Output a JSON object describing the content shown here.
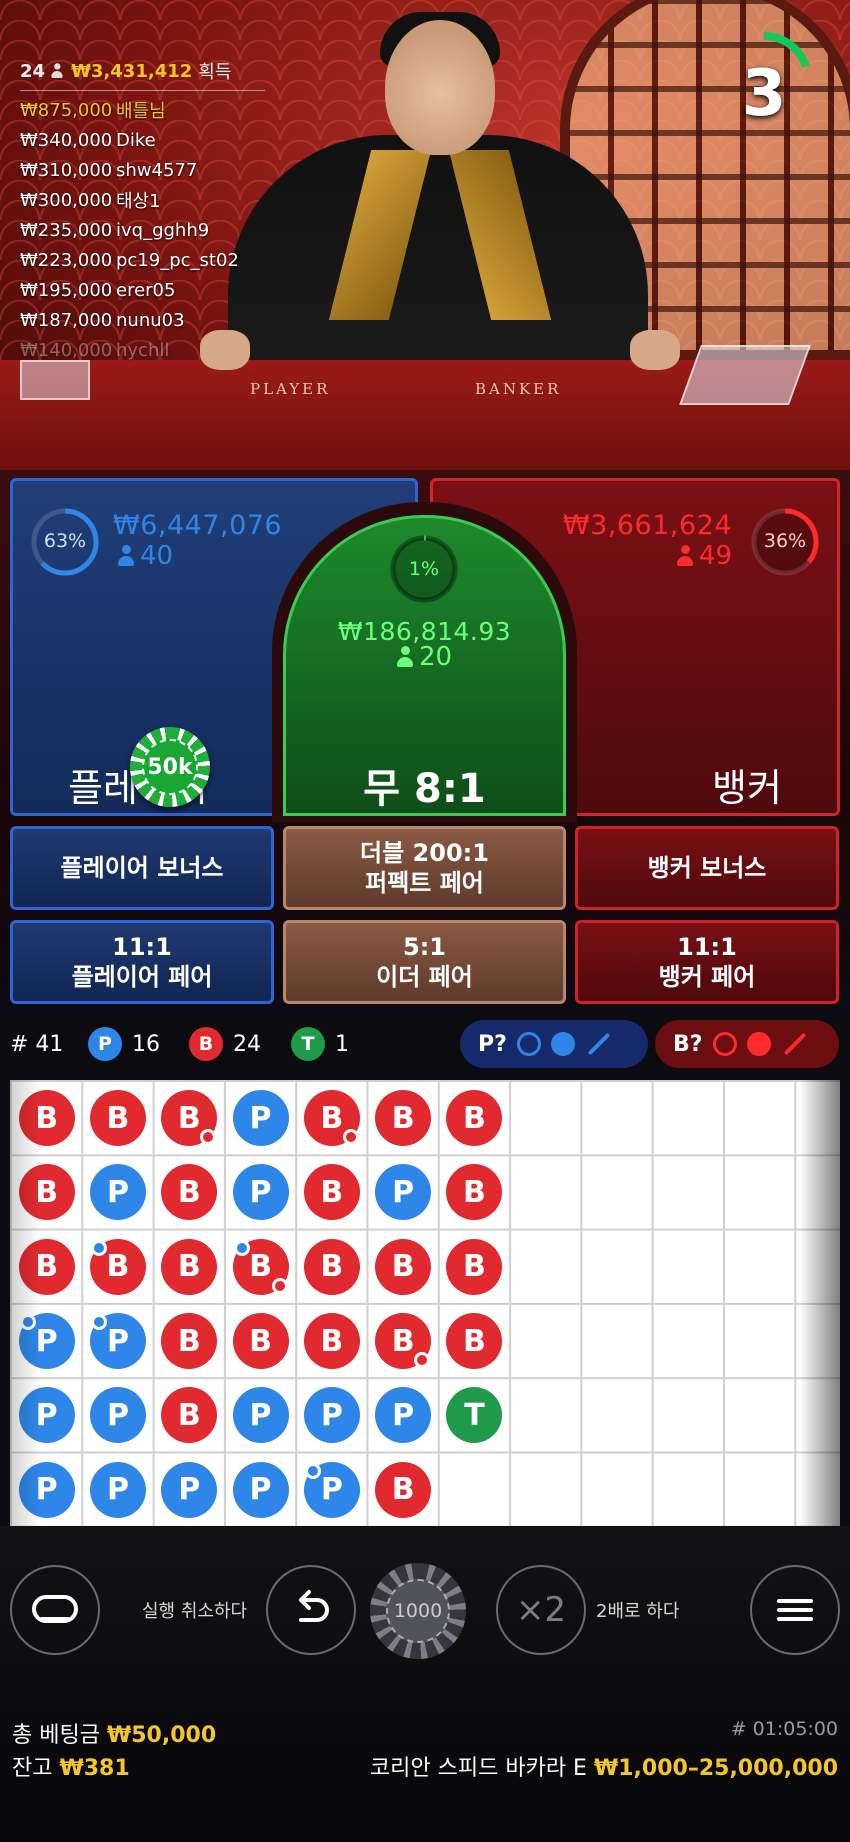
{
  "leaderboard": {
    "winners_count": "24",
    "total_win": "₩3,431,412",
    "total_label": "획득",
    "rows": [
      {
        "amount": "₩875,000",
        "name": "배틀님"
      },
      {
        "amount": "₩340,000",
        "name": "Dike"
      },
      {
        "amount": "₩310,000",
        "name": "shw4577"
      },
      {
        "amount": "₩300,000",
        "name": "태상1"
      },
      {
        "amount": "₩235,000",
        "name": "ivq_gghh9"
      },
      {
        "amount": "₩223,000",
        "name": "pc19_pc_st02"
      },
      {
        "amount": "₩195,000",
        "name": "erer05"
      },
      {
        "amount": "₩187,000",
        "name": "nunu03"
      },
      {
        "amount": "₩140,000",
        "name": "hychll"
      }
    ]
  },
  "table_labels": {
    "player": "PLAYER",
    "banker": "BANKER"
  },
  "timer": {
    "value": "3",
    "fraction_remaining": 0.2
  },
  "bets": {
    "player": {
      "percent": "63%",
      "percent_value": 63,
      "pool": "₩6,447,076",
      "bettors": "40",
      "title": "플레이어"
    },
    "tie": {
      "percent": "1%",
      "percent_value": 1,
      "pool": "₩186,814.93",
      "bettors": "20",
      "title": "무 8:1"
    },
    "banker": {
      "percent": "36%",
      "percent_value": 36,
      "pool": "₩3,661,624",
      "bettors": "49",
      "title": "뱅커"
    },
    "placed_chip": "50k"
  },
  "side_bets": [
    {
      "line1": "플레이어 보너스",
      "line2": ""
    },
    {
      "line1": "더블 200:1",
      "line2": "퍼펙트 페어"
    },
    {
      "line1": "뱅커 보너스",
      "line2": ""
    },
    {
      "line1": "11:1",
      "line2": "플레이어 페어"
    },
    {
      "line1": "5:1",
      "line2": "이더 페어"
    },
    {
      "line1": "11:1",
      "line2": "뱅커 페어"
    }
  ],
  "stats": {
    "round_label": "# 41",
    "player_letter": "P",
    "player_count": "16",
    "banker_letter": "B",
    "banker_count": "24",
    "tie_letter": "T",
    "tie_count": "1",
    "player_predict": "P?",
    "banker_predict": "B?"
  },
  "bead_road": {
    "columns": [
      [
        {
          "r": "B"
        },
        {
          "r": "B"
        },
        {
          "r": "B"
        },
        {
          "r": "P",
          "pp": true
        },
        {
          "r": "P"
        },
        {
          "r": "P"
        }
      ],
      [
        {
          "r": "B"
        },
        {
          "r": "P"
        },
        {
          "r": "B",
          "pp": true
        },
        {
          "r": "P",
          "pp": true
        },
        {
          "r": "P"
        },
        {
          "r": "P"
        }
      ],
      [
        {
          "r": "B",
          "bp": true
        },
        {
          "r": "B"
        },
        {
          "r": "B"
        },
        {
          "r": "B"
        },
        {
          "r": "B"
        },
        {
          "r": "P"
        }
      ],
      [
        {
          "r": "P"
        },
        {
          "r": "P"
        },
        {
          "r": "B",
          "pp": true,
          "bp": true
        },
        {
          "r": "B"
        },
        {
          "r": "P"
        },
        {
          "r": "P"
        }
      ],
      [
        {
          "r": "B",
          "bp": true
        },
        {
          "r": "B"
        },
        {
          "r": "B"
        },
        {
          "r": "B"
        },
        {
          "r": "P"
        },
        {
          "r": "P",
          "pp": true
        }
      ],
      [
        {
          "r": "B"
        },
        {
          "r": "P"
        },
        {
          "r": "B"
        },
        {
          "r": "B",
          "bp": true
        },
        {
          "r": "P"
        },
        {
          "r": "B"
        }
      ],
      [
        {
          "r": "B"
        },
        {
          "r": "B"
        },
        {
          "r": "B"
        },
        {
          "r": "B"
        },
        {
          "r": "T"
        }
      ]
    ]
  },
  "controls": {
    "undo_label": "실행 취소하다",
    "chip_value": "1000",
    "double_symbol": "×2",
    "double_label": "2배로 하다"
  },
  "footer": {
    "total_bet_label": "총 베팅금",
    "total_bet": "₩50,000",
    "balance_label": "잔고",
    "balance": "₩381",
    "round_id": "# 01:05:00",
    "table_name": "코리안 스피드 바카라 E",
    "limits": "₩1,000–25,000,000"
  },
  "colors": {
    "player": "#2e86e8",
    "banker": "#e02a2f",
    "tie": "#1f9a4a",
    "gold": "#f5c52c"
  }
}
